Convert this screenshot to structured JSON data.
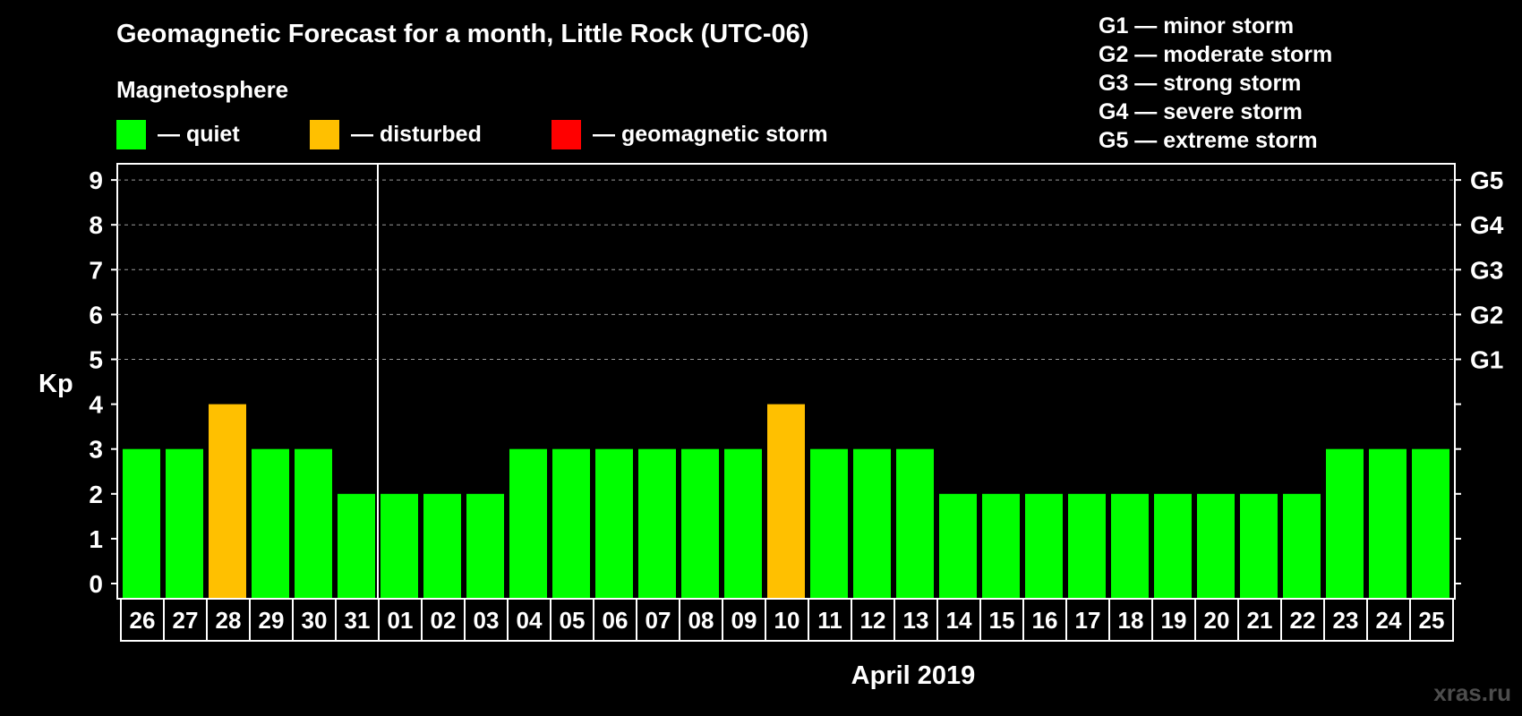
{
  "title": "Geomagnetic Forecast for a month, Little Rock (UTC-06)",
  "magnetosphere_label": "Magnetosphere",
  "legend": [
    {
      "label": "— quiet",
      "color": "#00ff00"
    },
    {
      "label": "— disturbed",
      "color": "#ffc000"
    },
    {
      "label": "— geomagnetic storm",
      "color": "#ff0000"
    }
  ],
  "storm_scale": [
    "G1 — minor storm",
    "G2 — moderate storm",
    "G3 — strong storm",
    "G4 — severe storm",
    "G5 — extreme storm"
  ],
  "watermark": "xras.ru",
  "chart_data": {
    "type": "bar",
    "title": "Geomagnetic Forecast for a month, Little Rock (UTC-06)",
    "ylabel": "Kp",
    "xlabel": "April 2019",
    "ylim": [
      0,
      9
    ],
    "yticks": [
      "0",
      "1",
      "2",
      "3",
      "4",
      "5",
      "6",
      "7",
      "8",
      "9"
    ],
    "right_ticks": [
      {
        "kp": 5,
        "label": "G1"
      },
      {
        "kp": 6,
        "label": "G2"
      },
      {
        "kp": 7,
        "label": "G3"
      },
      {
        "kp": 8,
        "label": "G4"
      },
      {
        "kp": 9,
        "label": "G5"
      }
    ],
    "grid": "dashed horizontal at Kp 5-9",
    "categories": [
      "26",
      "27",
      "28",
      "29",
      "30",
      "31",
      "01",
      "02",
      "03",
      "04",
      "05",
      "06",
      "07",
      "08",
      "09",
      "10",
      "11",
      "12",
      "13",
      "14",
      "15",
      "16",
      "17",
      "18",
      "19",
      "20",
      "21",
      "22",
      "23",
      "24",
      "25"
    ],
    "values": [
      3,
      3,
      4,
      3,
      3,
      2,
      2,
      2,
      2,
      3,
      3,
      3,
      3,
      3,
      3,
      4,
      3,
      3,
      3,
      2,
      2,
      2,
      2,
      2,
      2,
      2,
      2,
      2,
      3,
      3,
      3
    ],
    "month_boundary_after_index": 5,
    "colors": {
      "quiet": "#00ff00",
      "disturbed": "#ffc000",
      "storm": "#ff0000"
    }
  }
}
